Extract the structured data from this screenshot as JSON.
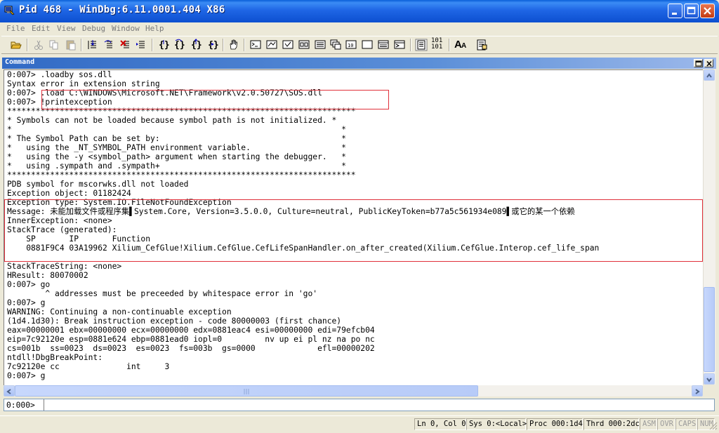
{
  "window": {
    "title": "Pid 468 - WinDbg:6.11.0001.404 X86"
  },
  "menu": [
    "File",
    "Edit",
    "View",
    "Debug",
    "Window",
    "Help"
  ],
  "toolbar": {
    "radix_label_top": "101",
    "radix_label_bottom": "101",
    "font_label": "A",
    "font_label_small": "A"
  },
  "command_window": {
    "title": "Command",
    "lines": [
      "0:007> .loadby sos.dll",
      "Syntax error in extension string",
      "0:007> .load C:\\WINDOWS\\Microsoft.NET\\Framework\\v2.0.50727\\SOS.dll",
      "0:007> !printexception",
      "*************************************************************************",
      "* Symbols can not be loaded because symbol path is not initialized. *",
      "*                                                                     *",
      "* The Symbol Path can be set by:                                      *",
      "*   using the _NT_SYMBOL_PATH environment variable.                   *",
      "*   using the -y <symbol_path> argument when starting the debugger.   *",
      "*   using .sympath and .sympath+                                      *",
      "*************************************************************************",
      "PDB symbol for mscorwks.dll not loaded",
      "Exception object: 01182424",
      "Exception type: System.IO.FileNotFoundException",
      "Message: 未能加载文件或程序集▌System.Core, Version=3.5.0.0, Culture=neutral, PublicKeyToken=b77a5c561934e089▌或它的某一个依赖",
      "InnerException: <none>",
      "StackTrace (generated):",
      "    SP       IP       Function",
      "    0881F9C4 03A19962 Xilium_CefGlue!Xilium.CefGlue.CefLifeSpanHandler.on_after_created(Xilium.CefGlue.Interop.cef_life_span",
      "",
      "StackTraceString: <none>",
      "HResult: 80070002",
      "0:007> go",
      "        ^ addresses must be preceeded by whitespace error in 'go'",
      "0:007> g",
      "WARNING: Continuing a non-continuable exception",
      "(1d4.1d30): Break instruction exception - code 80000003 (first chance)",
      "eax=00000001 ebx=00000000 ecx=00000000 edx=0881eac4 esi=00000000 edi=79efcb04",
      "eip=7c92120e esp=0881e624 ebp=0881ead0 iopl=0         nv up ei pl nz na po nc",
      "cs=001b  ss=0023  ds=0023  es=0023  fs=003b  gs=0000             efl=00000202",
      "ntdll!DbgBreakPoint:",
      "7c92120e cc              int     3",
      "0:007> g",
      ""
    ]
  },
  "input": {
    "prompt": "0:000>",
    "value": ""
  },
  "status": {
    "position": "Ln 0, Col 0",
    "sys": "Sys 0:<Local>",
    "proc": "Proc 000:1d4",
    "thrd": "Thrd 000:2dc",
    "asm": "ASM",
    "ovr": "OVR",
    "caps": "CAPS",
    "num": "NUM"
  }
}
